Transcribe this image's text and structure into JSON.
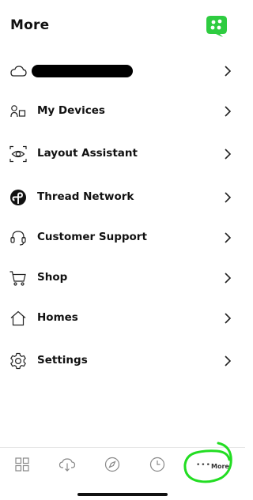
{
  "header": {
    "title": "More"
  },
  "colors": {
    "accent": "#2ecc40",
    "highlight": "#22dd22"
  },
  "menu": {
    "items": [
      {
        "label": "",
        "icon": "cloud-icon",
        "redacted": true
      },
      {
        "label": "My Devices",
        "icon": "devices-icon"
      },
      {
        "label": "Layout Assistant",
        "icon": "layout-assistant-icon"
      },
      {
        "label": "Thread Network",
        "icon": "thread-network-icon"
      },
      {
        "label": "Customer Support",
        "icon": "headset-icon"
      },
      {
        "label": "Shop",
        "icon": "cart-icon"
      },
      {
        "label": "Homes",
        "icon": "home-icon"
      },
      {
        "label": "Settings",
        "icon": "gear-icon"
      }
    ]
  },
  "tabbar": {
    "tabs": [
      {
        "icon": "grid-icon"
      },
      {
        "icon": "cloud-sync-icon"
      },
      {
        "icon": "compass-icon"
      },
      {
        "icon": "clock-icon"
      },
      {
        "icon": "more-dots-icon",
        "label": "More",
        "selected": true
      }
    ]
  }
}
